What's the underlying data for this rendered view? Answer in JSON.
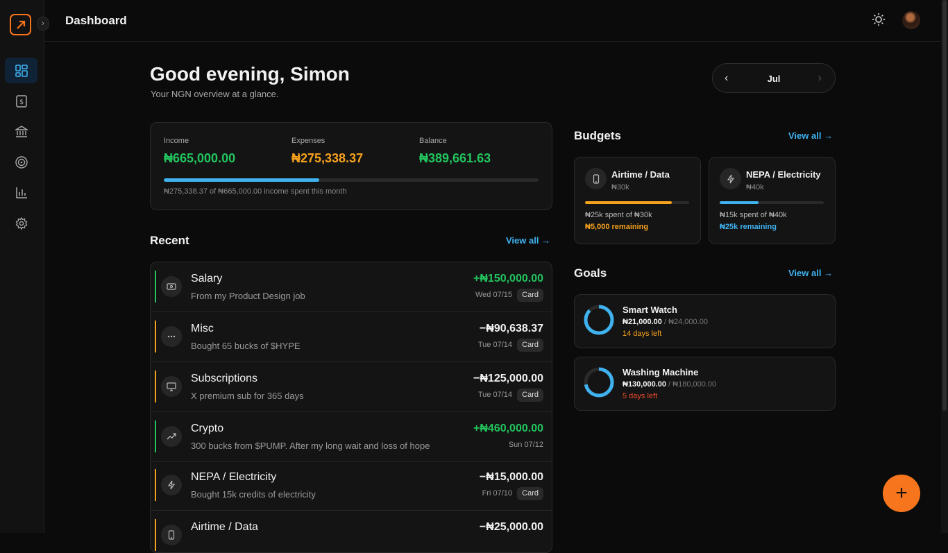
{
  "topbar": {
    "title": "Dashboard",
    "collapse_glyph": "›",
    "theme_icon": "sun-icon",
    "avatar": "user-avatar"
  },
  "sidebar": {
    "items": [
      {
        "icon": "dashboard-icon",
        "active": true
      },
      {
        "icon": "receipt-icon",
        "active": false
      },
      {
        "icon": "bank-icon",
        "active": false
      },
      {
        "icon": "target-icon",
        "active": false
      },
      {
        "icon": "chart-icon",
        "active": false
      },
      {
        "icon": "gear-icon",
        "active": false
      }
    ]
  },
  "header": {
    "greeting": "Good evening, Simon",
    "subtitle": "Your NGN overview at a glance."
  },
  "month_picker": {
    "label": "Jul",
    "prev": "‹",
    "next": "›"
  },
  "summary": {
    "income_label": "Income",
    "income": "₦665,000.00",
    "expenses_label": "Expenses",
    "expenses": "₦275,338.37",
    "balance_label": "Balance",
    "balance": "₦389,661.63",
    "spent_fraction": 0.414,
    "caption": "₦275,338.37 of ₦665,000.00 income spent this month"
  },
  "recent": {
    "title": "Recent",
    "view_all": "View all →",
    "items": [
      {
        "name": "Salary",
        "desc": "From my Product Design job",
        "amount": "+₦150,000.00",
        "date": "Wed 07/15",
        "badge": "Card",
        "type": "income"
      },
      {
        "name": "Misc",
        "desc": "Bought 65 bucks of $HYPE",
        "amount": "−₦90,638.37",
        "date": "Tue 07/14",
        "badge": "Card",
        "type": "expense"
      },
      {
        "name": "Subscriptions",
        "desc": "X premium sub for 365 days",
        "amount": "−₦125,000.00",
        "date": "Tue 07/14",
        "badge": "Card",
        "type": "expense"
      },
      {
        "name": "Crypto",
        "desc": "300 bucks from $PUMP. After my long wait and loss of hope",
        "amount": "+₦460,000.00",
        "date": "Sun 07/12",
        "badge": "",
        "type": "income"
      },
      {
        "name": "NEPA / Electricity",
        "desc": "Bought 15k credits of electricity",
        "amount": "−₦15,000.00",
        "date": "Fri 07/10",
        "badge": "Card",
        "type": "expense"
      },
      {
        "name": "Airtime / Data",
        "desc": "",
        "amount": "−₦25,000.00",
        "date": "",
        "badge": "",
        "type": "expense"
      }
    ]
  },
  "budgets": {
    "title": "Budgets",
    "view_all": "View all →",
    "items": [
      {
        "name": "Airtime / Data",
        "limit": "₦30k",
        "spent": "₦25k spent of ₦30k",
        "remaining": "₦5,000 remaining",
        "fraction": 0.833,
        "color": "#f7a21c",
        "icon": "phone-icon"
      },
      {
        "name": "NEPA / Electricity",
        "limit": "₦40k",
        "spent": "₦15k spent of ₦40k",
        "remaining": "₦25k remaining",
        "fraction": 0.375,
        "color": "#3fb2ef",
        "icon": "lightning-icon"
      }
    ]
  },
  "goals": {
    "title": "Goals",
    "view_all": "View all →",
    "items": [
      {
        "name": "Smart Watch",
        "saved": "₦21,000.00",
        "target": "₦24,000.00",
        "days": "14 days left",
        "fraction": 0.875,
        "days_color": "#f7a21c"
      },
      {
        "name": "Washing Machine",
        "saved": "₦130,000.00",
        "target": "₦180,000.00",
        "days": "5 days left",
        "fraction": 0.722,
        "days_color": "#ef4b2b"
      }
    ]
  },
  "fab": {
    "label": "+"
  },
  "colors": {
    "accent": "#f7751c",
    "income": "#22c55e",
    "expense": "#f7a21c",
    "link": "#3fb2ef",
    "track": "#2a2a2a"
  }
}
